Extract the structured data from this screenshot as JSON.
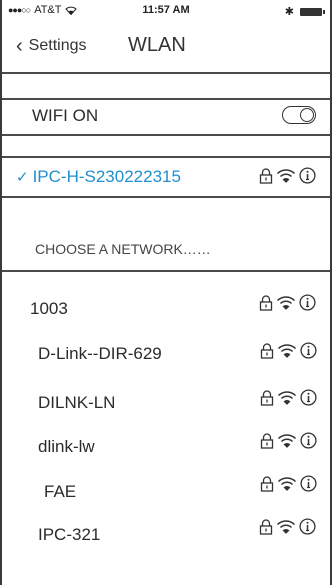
{
  "status_bar": {
    "carrier": "AT&T",
    "time": "11:57 AM"
  },
  "nav": {
    "back_label": "Settings",
    "title": "WLAN"
  },
  "wifi_toggle": {
    "label": "WIFI ON",
    "state": "on"
  },
  "connected_network": {
    "name": "IPC-H-S230222315",
    "accent_color": "#1f8fcf"
  },
  "network_list": {
    "header": "CHOOSE A NETWORK……",
    "networks": [
      {
        "name": "1003",
        "icons": [
          "lock-icon",
          "wifi-icon",
          "info-icon"
        ]
      },
      {
        "name": "D-Link--DIR-629",
        "icons": [
          "lock-icon",
          "wifi-icon",
          "info-icon"
        ]
      },
      {
        "name": "DILNK-LN",
        "icons": [
          "lock-icon",
          "wifi-icon",
          "info-icon"
        ]
      },
      {
        "name": "dlink-lw",
        "icons": [
          "lock-icon",
          "wifi-icon",
          "info-icon"
        ]
      },
      {
        "name": "FAE",
        "icons": [
          "lock-icon",
          "wifi-icon",
          "info-icon"
        ]
      },
      {
        "name": "IPC-321",
        "icons": [
          "lock-icon",
          "wifi-icon",
          "info-icon"
        ]
      }
    ]
  }
}
